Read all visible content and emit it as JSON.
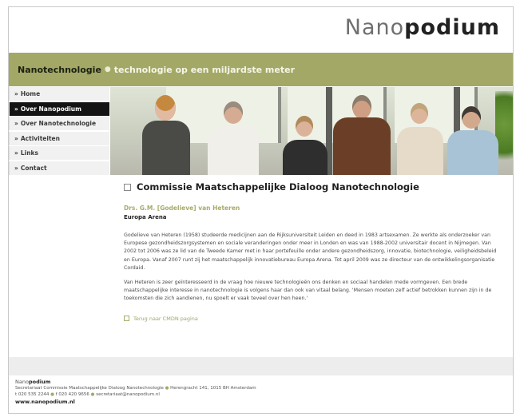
{
  "logo": {
    "light": "Nano",
    "bold": "podium"
  },
  "banner": {
    "topic": "Nanotechnologie",
    "separator": "●",
    "tagline": "technologie op een miljardste meter"
  },
  "nav": {
    "bullet": "»",
    "items": [
      {
        "label": "Home"
      },
      {
        "label": "Over Nanopodium"
      },
      {
        "label": "Over Nanotechnologie"
      },
      {
        "label": "Activiteiten"
      },
      {
        "label": "Links"
      },
      {
        "label": "Contact"
      }
    ]
  },
  "content": {
    "title": "Commissie Maatschappelijke Dialoog Nanotechnologie",
    "author": "Drs. G.M. [Godelieve] van Heteren",
    "organization": "Europa Arena",
    "paragraph1": "Godelieve van Heteren (1958) studeerde medicijnen aan de Rijksuniversiteit Leiden en deed in 1983 artsexamen. Ze werkte als onderzoeker van Europese gezondheidszorgsystemen en sociale veranderingen onder meer in Londen en was van 1988-2002 universitair docent in Nijmegen. Van 2002 tot 2006 was ze lid van de Tweede Kamer met in haar portefeuille onder andere gezondheidszorg, innovatie, biotechnologie, veiligheidsbeleid en Europa. Vanaf 2007 runt zij het maatschappelijk innovatiebureau Europa Arena. Tot april 2009 was ze directeur van de ontwikkelingsorganisatie Cordaid.",
    "paragraph2": "Van Heteren is zeer geïnteresseerd in de vraag hoe nieuwe technologieën ons denken en sociaal handelen mede vormgeven. Een brede maatschappelijke interesse in nanotechnologie is volgens haar dan ook van vitaal belang. 'Mensen moeten zelf actief betrokken kunnen zijn in de toekomsten die zich aandienen, nu spoelt er vaak teveel over hen heen.'",
    "back_link": "Terug naar CMDN pagina"
  },
  "footer": {
    "brand_light": "Nano",
    "brand_bold": "podium",
    "line1a": "Secretariaat Commissie Maatschappelijke Dialoog Nanotechnologie",
    "line1b": "Herengracht 141, 1015 BH Amsterdam",
    "line2a": "t 020 535 2244",
    "line2b": "f 020 420 9656",
    "line2c": "secretariaat@nanopodium.nl",
    "web": "www.nanopodium.nl",
    "dot": "●"
  },
  "colors": {
    "accent_green": "#a3a866",
    "nav_active": "#141414"
  }
}
